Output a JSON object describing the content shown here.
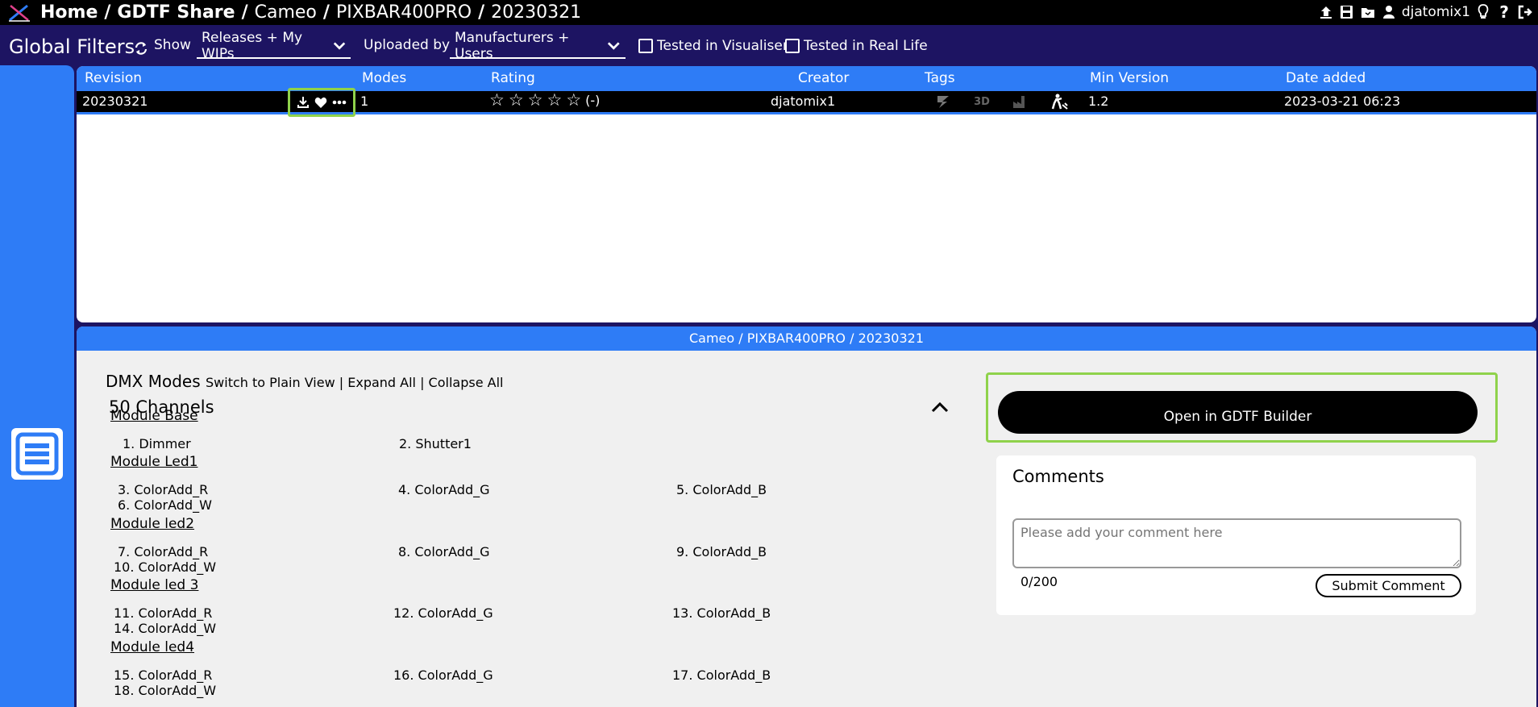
{
  "breadcrumb": {
    "home": "Home",
    "share": "GDTF Share",
    "manufacturer": "Cameo",
    "fixture": "PIXBAR400PRO",
    "revision": "20230321"
  },
  "user": {
    "name": "djatomix1"
  },
  "filters": {
    "title": "Global Filters",
    "show_label": "Show",
    "show_value": "Releases + My WIPs",
    "uploaded_label": "Uploaded by",
    "uploaded_value": "Manufacturers + Users",
    "tested_visualiser": "Tested in Visualiser",
    "tested_real_life": "Tested in Real Life"
  },
  "table": {
    "headers": {
      "revision": "Revision",
      "modes": "Modes",
      "rating": "Rating",
      "creator": "Creator",
      "tags": "Tags",
      "min_version": "Min Version",
      "date_added": "Date added"
    },
    "row": {
      "revision": "20230321",
      "modes": "1",
      "rating_text": "(-)",
      "creator": "djatomix1",
      "tag_3d": "3D",
      "min_version": "1.2",
      "date_added": "2023-03-21 06:23"
    }
  },
  "detail": {
    "header": "Cameo / PIXBAR400PRO / 20230321",
    "dmx_title": "DMX Modes",
    "links": "Switch to Plain View | Expand All | Collapse All",
    "channel_count": "50 Channels",
    "modules": [
      {
        "name": "Module Base",
        "channels": [
          "1. Dimmer",
          "2. Shutter1"
        ]
      },
      {
        "name": "Module Led1",
        "channels": [
          "3. ColorAdd_R",
          "4. ColorAdd_G",
          "5. ColorAdd_B",
          "6. ColorAdd_W"
        ]
      },
      {
        "name": "Module led2",
        "channels": [
          "7. ColorAdd_R",
          "8. ColorAdd_G",
          "9. ColorAdd_B",
          "10. ColorAdd_W"
        ]
      },
      {
        "name": "Module led 3",
        "channels": [
          "11. ColorAdd_R",
          "12. ColorAdd_G",
          "13. ColorAdd_B",
          "14. ColorAdd_W"
        ]
      },
      {
        "name": "Module led4",
        "channels": [
          "15. ColorAdd_R",
          "16. ColorAdd_G",
          "17. ColorAdd_B",
          "18. ColorAdd_W"
        ]
      }
    ],
    "builder_button": "Open in GDTF Builder",
    "comments": {
      "title": "Comments",
      "placeholder": "Please add your comment here",
      "count": "0/200",
      "submit": "Submit Comment"
    }
  },
  "colors": {
    "accent": "#2e7cf6",
    "navy": "#1d1462",
    "highlight": "#8fd24b"
  }
}
